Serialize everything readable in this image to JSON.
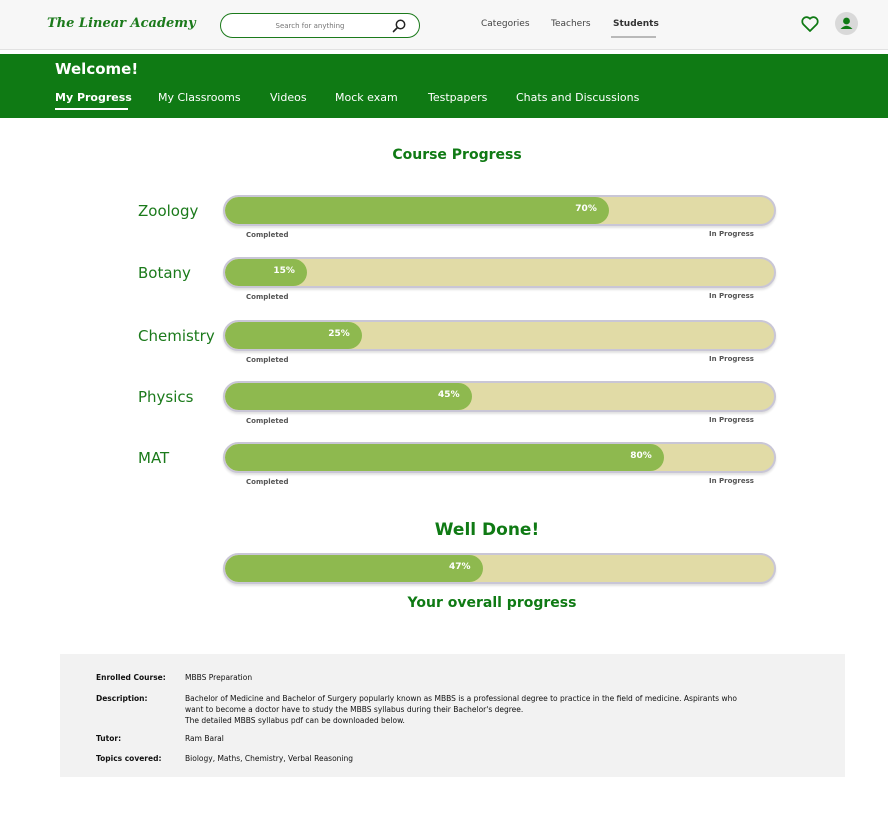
{
  "header": {
    "logo": "The Linear Academy",
    "search_placeholder": "Search for anything",
    "nav": [
      "Categories",
      "Teachers",
      "Students"
    ],
    "active_nav": "Students"
  },
  "band": {
    "welcome": "Welcome!",
    "tabs": [
      "My Progress",
      "My Classrooms",
      "Videos",
      "Mock exam",
      "Testpapers",
      "Chats and Discussions"
    ],
    "active_tab": "My Progress"
  },
  "progress": {
    "title": "Course Progress",
    "completed_label": "Completed",
    "in_progress_label": "In Progress",
    "subjects": [
      {
        "name": "Zoology",
        "percent": 70,
        "label": "70%"
      },
      {
        "name": "Botany",
        "percent": 15,
        "label": "15%"
      },
      {
        "name": "Chemistry",
        "percent": 25,
        "label": "25%"
      },
      {
        "name": "Physics",
        "percent": 45,
        "label": "45%"
      },
      {
        "name": "MAT",
        "percent": 80,
        "label": "80%"
      }
    ]
  },
  "overall": {
    "heading": "Well Done!",
    "percent": 47,
    "label": "47%",
    "caption": "Your overall progress"
  },
  "course": {
    "enrolled_key": "Enrolled Course:",
    "enrolled_value": "MBBS Preparation",
    "description_key": "Description:",
    "description_line1": "Bachelor of Medicine and Bachelor of Surgery popularly known as MBBS is a professional degree to practice in the field of medicine. Aspirants  who",
    "description_line2": "want to become a doctor have to study the MBBS syllabus during their Bachelor's degree.",
    "description_line3": "The detailed MBBS syllabus pdf can be downloaded below.",
    "tutor_key": "Tutor:",
    "tutor_value": "Ram Baral",
    "topics_key": "Topics covered:",
    "topics_value": "Biology, Maths, Chemistry, Verbal Reasoning"
  },
  "colors": {
    "brand_green": "#0f7a14",
    "fill_green": "#8eb94f",
    "track": "#e1dba6"
  }
}
